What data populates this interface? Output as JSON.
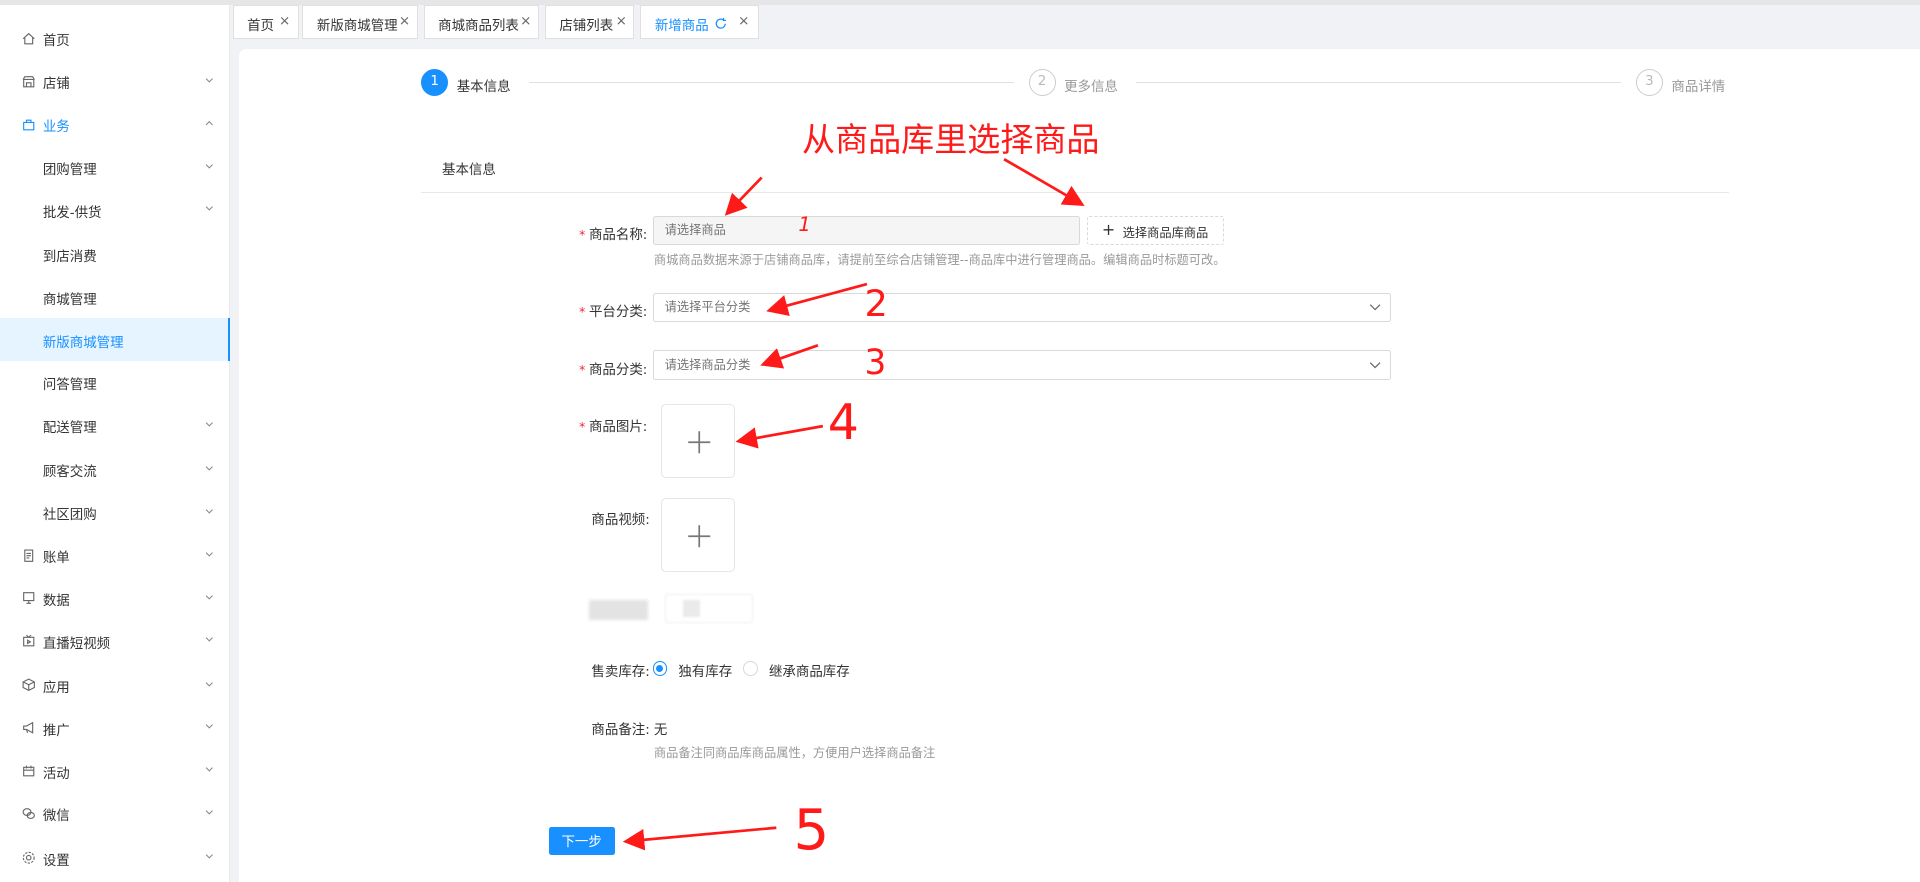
{
  "sidebar": {
    "items": [
      {
        "label": "首页",
        "icon": "home-icon"
      },
      {
        "label": "店铺",
        "icon": "store-icon"
      },
      {
        "label": "业务",
        "icon": "briefcase-icon"
      },
      {
        "label": "团购管理"
      },
      {
        "label": "批发-供货"
      },
      {
        "label": "到店消费"
      },
      {
        "label": "商城管理"
      },
      {
        "label": "新版商城管理"
      },
      {
        "label": "问答管理"
      },
      {
        "label": "配送管理"
      },
      {
        "label": "顾客交流"
      },
      {
        "label": "社区团购"
      },
      {
        "label": "账单",
        "icon": "bill-icon"
      },
      {
        "label": "数据",
        "icon": "data-icon"
      },
      {
        "label": "直播短视频",
        "icon": "video-icon"
      },
      {
        "label": "应用",
        "icon": "app-icon"
      },
      {
        "label": "推广",
        "icon": "megaphone-icon"
      },
      {
        "label": "活动",
        "icon": "activity-icon"
      },
      {
        "label": "微信",
        "icon": "wechat-icon"
      },
      {
        "label": "设置",
        "icon": "settings-icon"
      }
    ]
  },
  "tabs": [
    {
      "label": "首页"
    },
    {
      "label": "新版商城管理"
    },
    {
      "label": "商城商品列表"
    },
    {
      "label": "店铺列表"
    },
    {
      "label": "新增商品"
    }
  ],
  "steps": [
    {
      "num": "1",
      "label": "基本信息"
    },
    {
      "num": "2",
      "label": "更多信息"
    },
    {
      "num": "3",
      "label": "商品详情"
    }
  ],
  "section_title": "基本信息",
  "form": {
    "name_label": "商品名称:",
    "name_placeholder": "请选择商品",
    "pick_button": "选择商品库商品",
    "name_hint": "商城商品数据来源于店铺商品库，请提前至综合店铺管理--商品库中进行管理商品。编辑商品时标题可改。",
    "platform_label": "平台分类:",
    "platform_placeholder": "请选择平台分类",
    "category_label": "商品分类:",
    "category_placeholder": "请选择商品分类",
    "image_label": "商品图片:",
    "video_label": "商品视频:",
    "stock_label": "售卖库存:",
    "stock_options": [
      "独有库存",
      "继承商品库存"
    ],
    "note_label": "商品备注:",
    "note_value": "无",
    "note_hint": "商品备注同商品库商品属性，方便用户选择商品备注",
    "next_button": "下一步"
  },
  "annotations": {
    "title": "从商品库里选择商品",
    "n1": "1",
    "n2": "2",
    "n3": "3",
    "n4": "4",
    "n5": "5"
  },
  "colors": {
    "accent": "#1890ff",
    "annotation": "#ff1a1a",
    "required": "#f5222d"
  }
}
